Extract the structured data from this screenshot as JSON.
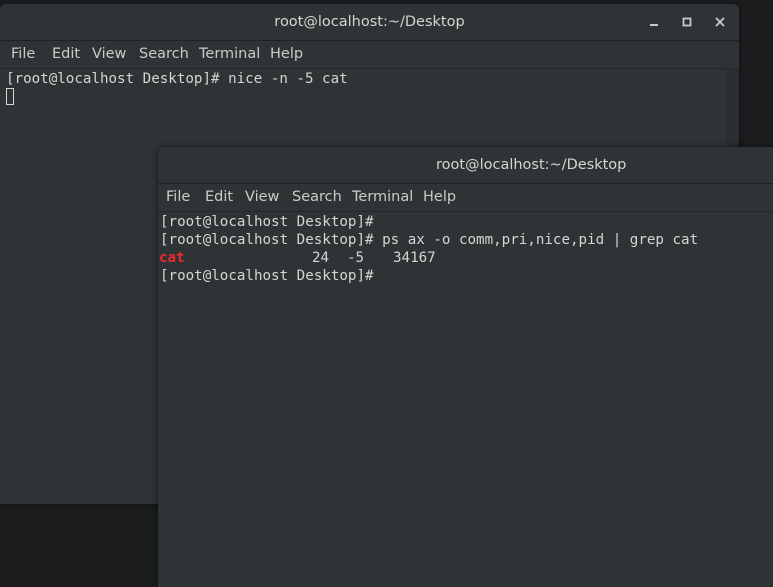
{
  "windows": [
    {
      "title": "root@localhost:~/Desktop",
      "menu": [
        "File",
        "Edit",
        "View",
        "Search",
        "Terminal",
        "Help"
      ],
      "lines": [
        "[root@localhost Desktop]# nice -n -5 cat"
      ]
    },
    {
      "title": "root@localhost:~/Desktop",
      "menu": [
        "File",
        "Edit",
        "View",
        "Search",
        "Terminal",
        "Help"
      ],
      "lines": [
        "[root@localhost Desktop]#",
        "[root@localhost Desktop]# ps ax -o comm,pri,nice,pid | grep cat",
        "[root@localhost Desktop]#"
      ],
      "process_row": {
        "comm": "cat",
        "pri": "24",
        "nice": "-5",
        "pid": "34167"
      }
    }
  ],
  "icons": {
    "minimize": "minimize-icon",
    "maximize": "maximize-icon",
    "close": "close-icon"
  },
  "colors": {
    "terminal_bg": "#2e3436",
    "terminal_fg": "#d3d7cf",
    "grep_highlight": "#ef2929"
  }
}
